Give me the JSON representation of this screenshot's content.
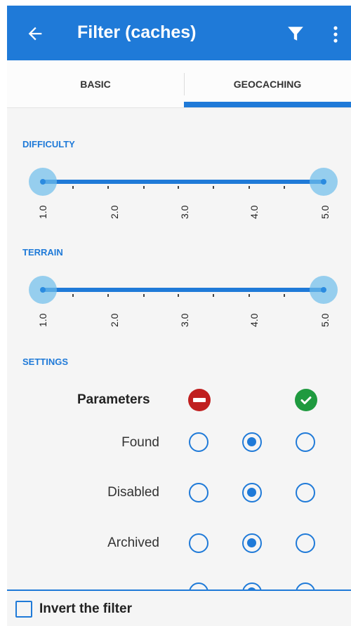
{
  "appbar": {
    "title": "Filter (caches)",
    "back_icon": "arrow-left-icon",
    "filter_icon": "funnel-icon",
    "more_icon": "more-vert-icon",
    "color": "#1f7ad8"
  },
  "tabs": [
    {
      "label": "BASIC",
      "active": false
    },
    {
      "label": "GEOCACHING",
      "active": true
    }
  ],
  "difficulty": {
    "label": "DIFFICULTY",
    "min": 1.0,
    "max": 5.0,
    "selected_range": [
      1.0,
      5.0
    ],
    "tick_labels": [
      "1.0",
      "2.0",
      "3.0",
      "4.0",
      "5.0"
    ]
  },
  "terrain": {
    "label": "TERRAIN",
    "min": 1.0,
    "max": 5.0,
    "selected_range": [
      1.0,
      5.0
    ],
    "tick_labels": [
      "1.0",
      "2.0",
      "3.0",
      "4.0",
      "5.0"
    ]
  },
  "settings": {
    "label": "SETTINGS",
    "header": "Parameters",
    "exclude_icon": "minus-circle-icon",
    "include_icon": "check-circle-icon",
    "exclude_color": "#c01f1f",
    "include_color": "#1f9a3f",
    "rows": [
      {
        "label": "Found",
        "selected": 1
      },
      {
        "label": "Disabled",
        "selected": 1
      },
      {
        "label": "Archived",
        "selected": 1
      }
    ]
  },
  "bottom": {
    "invert_label": "Invert the filter",
    "invert_checked": false
  }
}
